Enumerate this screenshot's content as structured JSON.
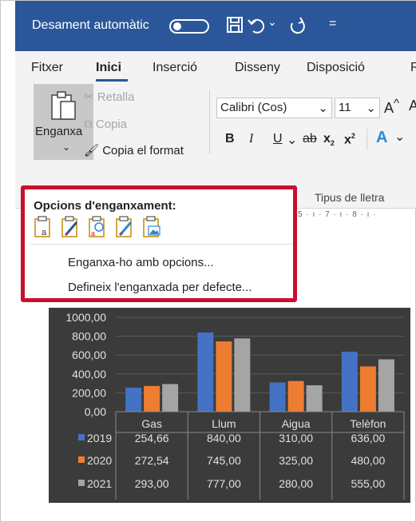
{
  "titlebar": {
    "autosave_label": "Desament automàtic",
    "autosave_on": false,
    "qat_more": "="
  },
  "tabs": [
    {
      "label": "Fitxer"
    },
    {
      "label": "Inici"
    },
    {
      "label": "Inserció"
    },
    {
      "label": "Disseny"
    },
    {
      "label": "Disposició"
    },
    {
      "label": "R"
    }
  ],
  "ribbon": {
    "paste_label": "Enganxa",
    "cut_label": "Retalla",
    "copy_label": "Copia",
    "format_painter_label": "Copia el format",
    "font_name": "Calibri (Cos)",
    "font_size": "11",
    "bold": "B",
    "italic": "I",
    "underline": "U",
    "strike": "ab",
    "subscript": "x",
    "superscript": "x",
    "font_group_label": "Tipus de lletra"
  },
  "ruler_text": "5 · ı · 7 · ı · 8 · ı ·",
  "paste_options": {
    "title": "Opcions d'enganxament:",
    "icons": [
      "keep-source-format-icon",
      "merge-format-icon",
      "keep-text-icon",
      "picture-paste-icon",
      "paste-as-picture-icon"
    ],
    "item1": "Enganxa-ho amb opcions...",
    "item2": "Defineix l'enganxada per defecte..."
  },
  "colors": {
    "titlebar": "#2b579a",
    "accent_red": "#c8102e",
    "series_2019": "#4472c4",
    "series_2020": "#ed7d31",
    "series_2021": "#a5a5a5",
    "chart_bg": "#3b3b3b"
  },
  "chart_data": {
    "type": "bar",
    "categories": [
      "Gas",
      "Llum",
      "Aigua",
      "Telèfon"
    ],
    "series": [
      {
        "name": "2019",
        "values": [
          254.66,
          840.0,
          310.0,
          636.0
        ],
        "labels": [
          "254,66",
          "840,00",
          "310,00",
          "636,00"
        ],
        "color": "#4472c4"
      },
      {
        "name": "2020",
        "values": [
          272.54,
          745.0,
          325.0,
          480.0
        ],
        "labels": [
          "272,54",
          "745,00",
          "325,00",
          "480,00"
        ],
        "color": "#ed7d31"
      },
      {
        "name": "2021",
        "values": [
          293.0,
          777.0,
          280.0,
          555.0
        ],
        "labels": [
          "293,00",
          "777,00",
          "280,00",
          "555,00"
        ],
        "color": "#a5a5a5"
      }
    ],
    "yticks": [
      "0,00",
      "200,00",
      "400,00",
      "600,00",
      "800,00",
      "1000,00"
    ],
    "ylim": [
      0,
      1000
    ],
    "grid": true,
    "legend": "data-table"
  }
}
